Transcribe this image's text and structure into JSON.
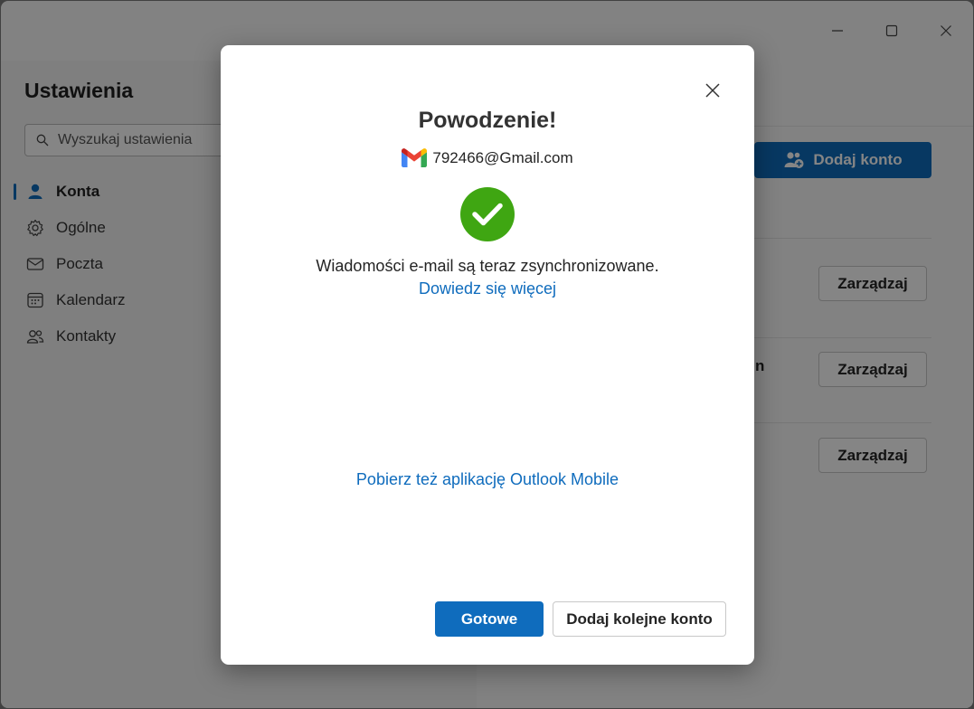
{
  "settings": {
    "title": "Ustawienia",
    "search_placeholder": "Wyszukaj ustawienia",
    "nav": [
      {
        "label": "Konta",
        "icon": "person-icon",
        "active": true
      },
      {
        "label": "Ogólne",
        "icon": "gear-icon",
        "active": false
      },
      {
        "label": "Poczta",
        "icon": "mail-icon",
        "active": false
      },
      {
        "label": "Kalendarz",
        "icon": "calendar-icon",
        "active": false
      },
      {
        "label": "Kontakty",
        "icon": "people-icon",
        "active": false
      }
    ]
  },
  "accounts_panel": {
    "add_account_label": "Dodaj konto",
    "manage_label": "Zarządzaj",
    "partial_account_text": "n"
  },
  "dialog": {
    "title": "Powodzenie!",
    "account_email": "792466@Gmail.com",
    "account_icon": "gmail-icon",
    "status_icon": "success-checkmark-icon",
    "message": "Wiadomości e-mail są teraz zsynchronizowane.",
    "learn_more_link": "Dowiedz się więcej",
    "mobile_app_link": "Pobierz też aplikację Outlook Mobile",
    "done_button": "Gotowe",
    "add_another_button": "Dodaj kolejne konto"
  },
  "colors": {
    "accent": "#0f6cbd",
    "success": "#3fa612"
  }
}
